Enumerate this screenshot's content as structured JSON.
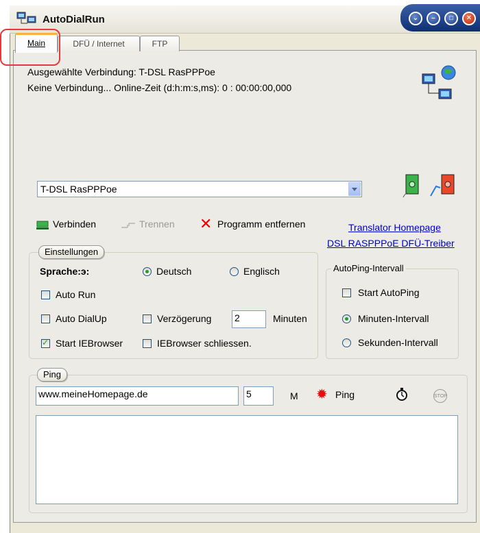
{
  "window": {
    "title": "AutoDialRun"
  },
  "tabs": [
    {
      "label": "Main"
    },
    {
      "label": "DFÜ / Internet"
    },
    {
      "label": "FTP"
    }
  ],
  "status": {
    "selected": "Ausgewählte Verbindung: T-DSL RasPPPoe",
    "state": "Keine Verbindung...  Online-Zeit (d:h:m:s,ms): 0 : 00:00:00,000"
  },
  "connection_select": {
    "value": "T-DSL RasPPPoe"
  },
  "actions": {
    "connect": "Verbinden",
    "disconnect": "Trennen",
    "remove": "Programm entfernen"
  },
  "links": {
    "translator": "Translator Homepage",
    "driver": "DSL RASPPPoE DFÜ-Treiber"
  },
  "settings": {
    "title": "Einstellungen",
    "language_label": "Sprache:э:",
    "german": "Deutsch",
    "english": "Englisch",
    "auto_run": "Auto Run",
    "auto_dialup": "Auto DialUp",
    "delay": "Verzögerung",
    "delay_value": "2",
    "minutes": "Minuten",
    "start_ie": "Start IEBrowser",
    "close_ie": "IEBrowser schliessen."
  },
  "autoping": {
    "title": "AutoPing-Intervall",
    "start": "Start AutoPing",
    "minutes": "Minuten-Intervall",
    "seconds": "Sekunden-Intervall"
  },
  "ping": {
    "title": "Ping",
    "host": "www.meineHomepage.de",
    "count": "5",
    "unit": "M",
    "button": "Ping",
    "stop_label": "STOP"
  }
}
